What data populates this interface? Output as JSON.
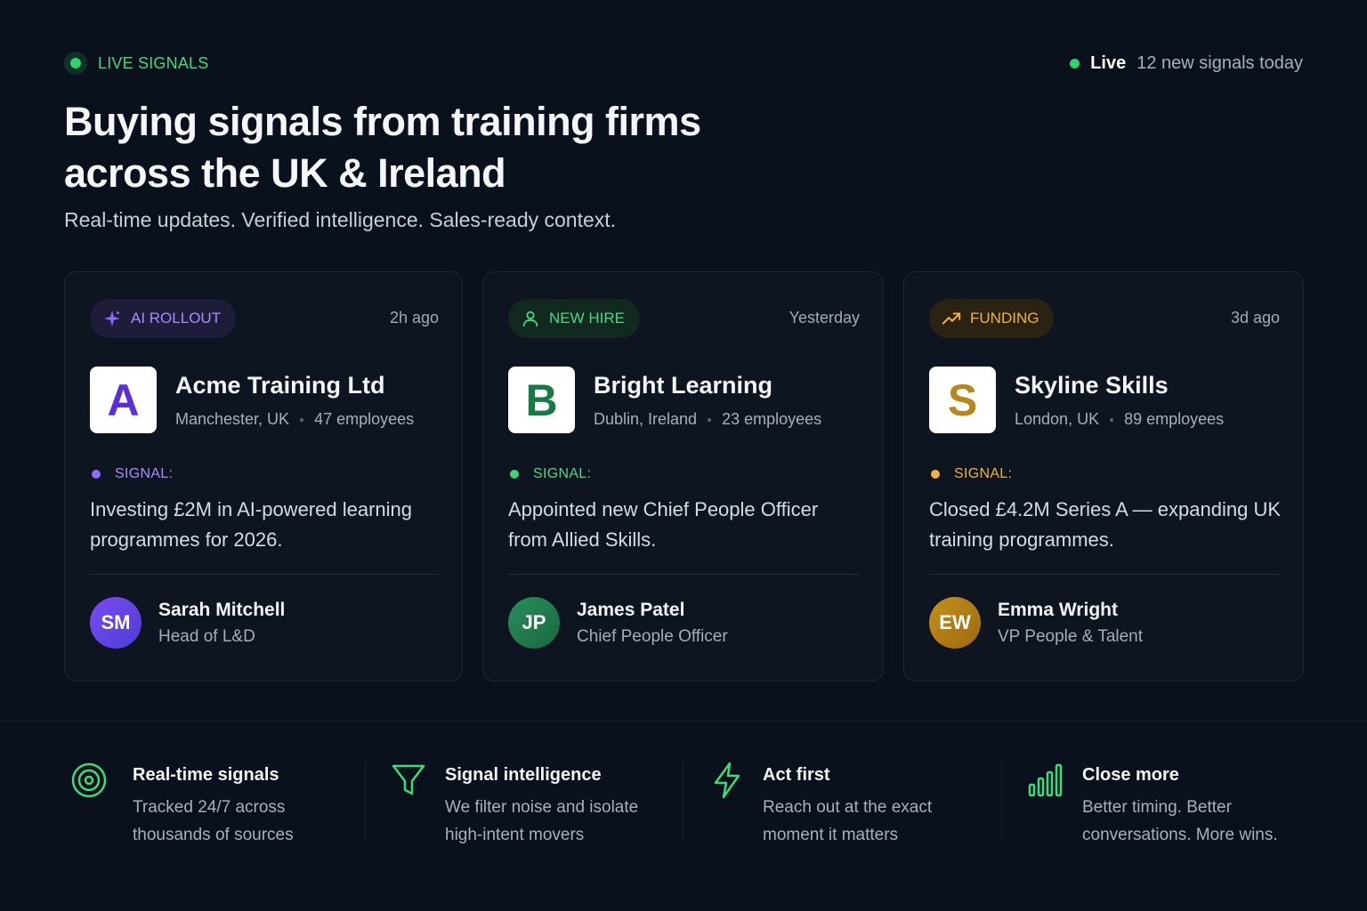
{
  "header": {
    "eyebrow": "LIVE SIGNALS",
    "live_label": "Live",
    "live_count": "12 new signals today",
    "title": "Buying signals from training firms across the UK & Ireland",
    "subtitle": "Real-time updates. Verified intelligence. Sales-ready context."
  },
  "cards": [
    {
      "tag": "AI ROLLOUT",
      "tag_icon": "sparkle-icon",
      "time": "2h ago",
      "logo_letter": "A",
      "company": "Acme Training Ltd",
      "location": "Manchester, UK",
      "employees": "47 employees",
      "signal_label": "SIGNAL:",
      "signal_text": "Investing £2M in AI-powered learning programmes for 2026.",
      "initials": "SM",
      "person": "Sarah Mitchell",
      "role": "Head of L&D",
      "accent": "#9b7bff"
    },
    {
      "tag": "NEW HIRE",
      "tag_icon": "person-icon",
      "time": "Yesterday",
      "logo_letter": "B",
      "company": "Bright Learning",
      "location": "Dublin, Ireland",
      "employees": "23 employees",
      "signal_label": "SIGNAL:",
      "signal_text": "Appointed new Chief People Officer from Allied Skills.",
      "initials": "JP",
      "person": "James Patel",
      "role": "Chief People Officer",
      "accent": "#3ed47a"
    },
    {
      "tag": "FUNDING",
      "tag_icon": "trending-up-icon",
      "time": "3d ago",
      "logo_letter": "S",
      "company": "Skyline Skills",
      "location": "London, UK",
      "employees": "89 employees",
      "signal_label": "SIGNAL:",
      "signal_text": "Closed £4.2M Series A — expanding UK training programmes.",
      "initials": "EW",
      "person": "Emma Wright",
      "role": "VP People & Talent",
      "accent": "#f2b33a"
    }
  ],
  "features": [
    {
      "icon": "target-icon",
      "title": "Real-time signals",
      "desc": "Tracked 24/7 across thousands of sources"
    },
    {
      "icon": "funnel-icon",
      "title": "Signal intelligence",
      "desc": "We filter noise and isolate high-intent movers"
    },
    {
      "icon": "lightning-icon",
      "title": "Act first",
      "desc": "Reach out at the exact moment it matters"
    },
    {
      "icon": "bar-chart-icon",
      "title": "Close more",
      "desc": "Better timing. Better conversations. More wins."
    }
  ]
}
